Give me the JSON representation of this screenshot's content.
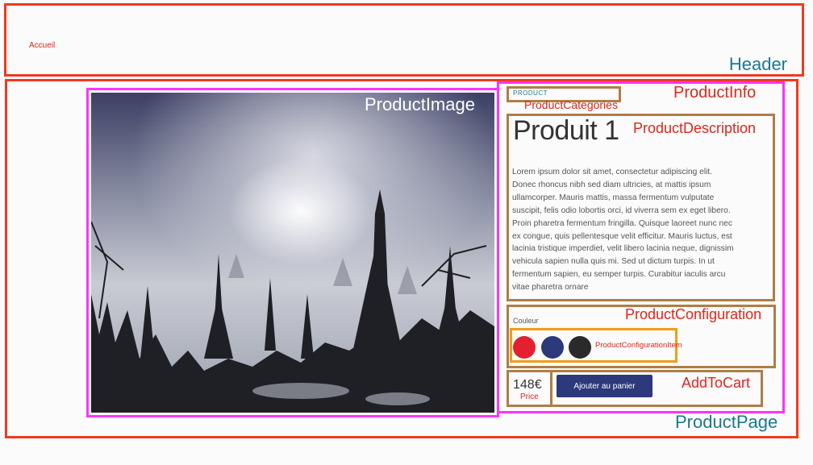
{
  "header": {
    "home_link": "Accueil",
    "annotation": "Header"
  },
  "page": {
    "annotation": "ProductPage"
  },
  "image": {
    "annotation": "ProductImage"
  },
  "info": {
    "annotation": "ProductInfo",
    "categories": {
      "text": "PRODUCT",
      "annotation": "ProductCategories"
    },
    "description": {
      "annotation": "ProductDescription",
      "title": "Produit 1",
      "body": "Lorem ipsum dolor sit amet, consectetur adipiscing elit. Donec rhoncus nibh sed diam ultricies, at mattis ipsum ullamcorper. Mauris mattis, massa fermentum vulputate suscipit, felis odio lobortis orci, id viverra sem ex eget libero. Proin pharetra fermentum fringilla. Quisque laoreet nunc nec ex congue, quis pellentesque velit efficitur. Mauris luctus, est lacinia tristique imperdiet, velit libero lacinia neque, dignissim vehicula sapien nulla quis mi. Sed ut dictum turpis. In ut fermentum sapien, eu semper turpis. Curabitur iaculis arcu vitae pharetra ornare"
    },
    "configuration": {
      "annotation": "ProductConfiguration",
      "label": "Couleur",
      "item_annotation": "ProductConfigurationItem",
      "swatches": [
        {
          "name": "red",
          "color": "#e3202f"
        },
        {
          "name": "blue",
          "color": "#2c3a7c"
        },
        {
          "name": "black",
          "color": "#2a2a2a"
        }
      ]
    },
    "add_to_cart": {
      "annotation": "AddToCart",
      "price": "148€",
      "price_annotation": "Price",
      "button_label": "Ajouter au panier"
    }
  },
  "colors": {
    "annotation_red": "#f2391f",
    "annotation_magenta": "#ff33ff",
    "annotation_brown": "#b07d45",
    "annotation_orange": "#f29c18",
    "annotation_teal_text": "#1a7a8c",
    "button_blue": "#2c3a7c"
  }
}
